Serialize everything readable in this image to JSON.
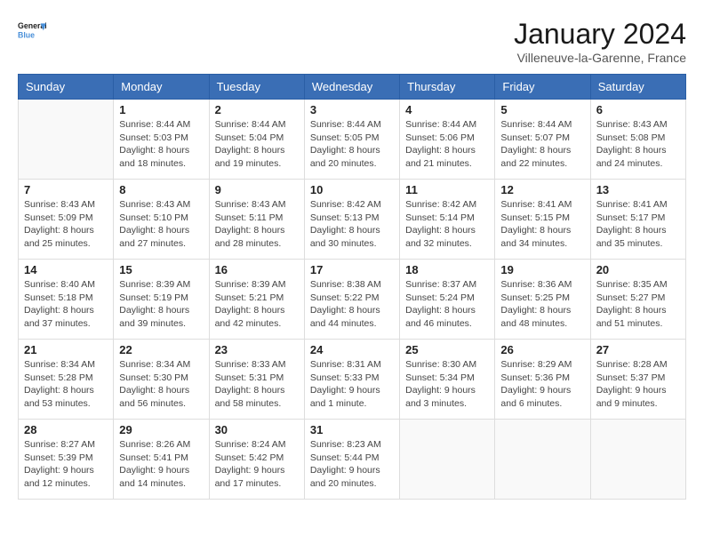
{
  "header": {
    "logo_general": "General",
    "logo_blue": "Blue",
    "month_title": "January 2024",
    "location": "Villeneuve-la-Garenne, France"
  },
  "days_of_week": [
    "Sunday",
    "Monday",
    "Tuesday",
    "Wednesday",
    "Thursday",
    "Friday",
    "Saturday"
  ],
  "weeks": [
    [
      {
        "day": "",
        "info": ""
      },
      {
        "day": "1",
        "info": "Sunrise: 8:44 AM\nSunset: 5:03 PM\nDaylight: 8 hours\nand 18 minutes."
      },
      {
        "day": "2",
        "info": "Sunrise: 8:44 AM\nSunset: 5:04 PM\nDaylight: 8 hours\nand 19 minutes."
      },
      {
        "day": "3",
        "info": "Sunrise: 8:44 AM\nSunset: 5:05 PM\nDaylight: 8 hours\nand 20 minutes."
      },
      {
        "day": "4",
        "info": "Sunrise: 8:44 AM\nSunset: 5:06 PM\nDaylight: 8 hours\nand 21 minutes."
      },
      {
        "day": "5",
        "info": "Sunrise: 8:44 AM\nSunset: 5:07 PM\nDaylight: 8 hours\nand 22 minutes."
      },
      {
        "day": "6",
        "info": "Sunrise: 8:43 AM\nSunset: 5:08 PM\nDaylight: 8 hours\nand 24 minutes."
      }
    ],
    [
      {
        "day": "7",
        "info": "Sunrise: 8:43 AM\nSunset: 5:09 PM\nDaylight: 8 hours\nand 25 minutes."
      },
      {
        "day": "8",
        "info": "Sunrise: 8:43 AM\nSunset: 5:10 PM\nDaylight: 8 hours\nand 27 minutes."
      },
      {
        "day": "9",
        "info": "Sunrise: 8:43 AM\nSunset: 5:11 PM\nDaylight: 8 hours\nand 28 minutes."
      },
      {
        "day": "10",
        "info": "Sunrise: 8:42 AM\nSunset: 5:13 PM\nDaylight: 8 hours\nand 30 minutes."
      },
      {
        "day": "11",
        "info": "Sunrise: 8:42 AM\nSunset: 5:14 PM\nDaylight: 8 hours\nand 32 minutes."
      },
      {
        "day": "12",
        "info": "Sunrise: 8:41 AM\nSunset: 5:15 PM\nDaylight: 8 hours\nand 34 minutes."
      },
      {
        "day": "13",
        "info": "Sunrise: 8:41 AM\nSunset: 5:17 PM\nDaylight: 8 hours\nand 35 minutes."
      }
    ],
    [
      {
        "day": "14",
        "info": "Sunrise: 8:40 AM\nSunset: 5:18 PM\nDaylight: 8 hours\nand 37 minutes."
      },
      {
        "day": "15",
        "info": "Sunrise: 8:39 AM\nSunset: 5:19 PM\nDaylight: 8 hours\nand 39 minutes."
      },
      {
        "day": "16",
        "info": "Sunrise: 8:39 AM\nSunset: 5:21 PM\nDaylight: 8 hours\nand 42 minutes."
      },
      {
        "day": "17",
        "info": "Sunrise: 8:38 AM\nSunset: 5:22 PM\nDaylight: 8 hours\nand 44 minutes."
      },
      {
        "day": "18",
        "info": "Sunrise: 8:37 AM\nSunset: 5:24 PM\nDaylight: 8 hours\nand 46 minutes."
      },
      {
        "day": "19",
        "info": "Sunrise: 8:36 AM\nSunset: 5:25 PM\nDaylight: 8 hours\nand 48 minutes."
      },
      {
        "day": "20",
        "info": "Sunrise: 8:35 AM\nSunset: 5:27 PM\nDaylight: 8 hours\nand 51 minutes."
      }
    ],
    [
      {
        "day": "21",
        "info": "Sunrise: 8:34 AM\nSunset: 5:28 PM\nDaylight: 8 hours\nand 53 minutes."
      },
      {
        "day": "22",
        "info": "Sunrise: 8:34 AM\nSunset: 5:30 PM\nDaylight: 8 hours\nand 56 minutes."
      },
      {
        "day": "23",
        "info": "Sunrise: 8:33 AM\nSunset: 5:31 PM\nDaylight: 8 hours\nand 58 minutes."
      },
      {
        "day": "24",
        "info": "Sunrise: 8:31 AM\nSunset: 5:33 PM\nDaylight: 9 hours\nand 1 minute."
      },
      {
        "day": "25",
        "info": "Sunrise: 8:30 AM\nSunset: 5:34 PM\nDaylight: 9 hours\nand 3 minutes."
      },
      {
        "day": "26",
        "info": "Sunrise: 8:29 AM\nSunset: 5:36 PM\nDaylight: 9 hours\nand 6 minutes."
      },
      {
        "day": "27",
        "info": "Sunrise: 8:28 AM\nSunset: 5:37 PM\nDaylight: 9 hours\nand 9 minutes."
      }
    ],
    [
      {
        "day": "28",
        "info": "Sunrise: 8:27 AM\nSunset: 5:39 PM\nDaylight: 9 hours\nand 12 minutes."
      },
      {
        "day": "29",
        "info": "Sunrise: 8:26 AM\nSunset: 5:41 PM\nDaylight: 9 hours\nand 14 minutes."
      },
      {
        "day": "30",
        "info": "Sunrise: 8:24 AM\nSunset: 5:42 PM\nDaylight: 9 hours\nand 17 minutes."
      },
      {
        "day": "31",
        "info": "Sunrise: 8:23 AM\nSunset: 5:44 PM\nDaylight: 9 hours\nand 20 minutes."
      },
      {
        "day": "",
        "info": ""
      },
      {
        "day": "",
        "info": ""
      },
      {
        "day": "",
        "info": ""
      }
    ]
  ]
}
